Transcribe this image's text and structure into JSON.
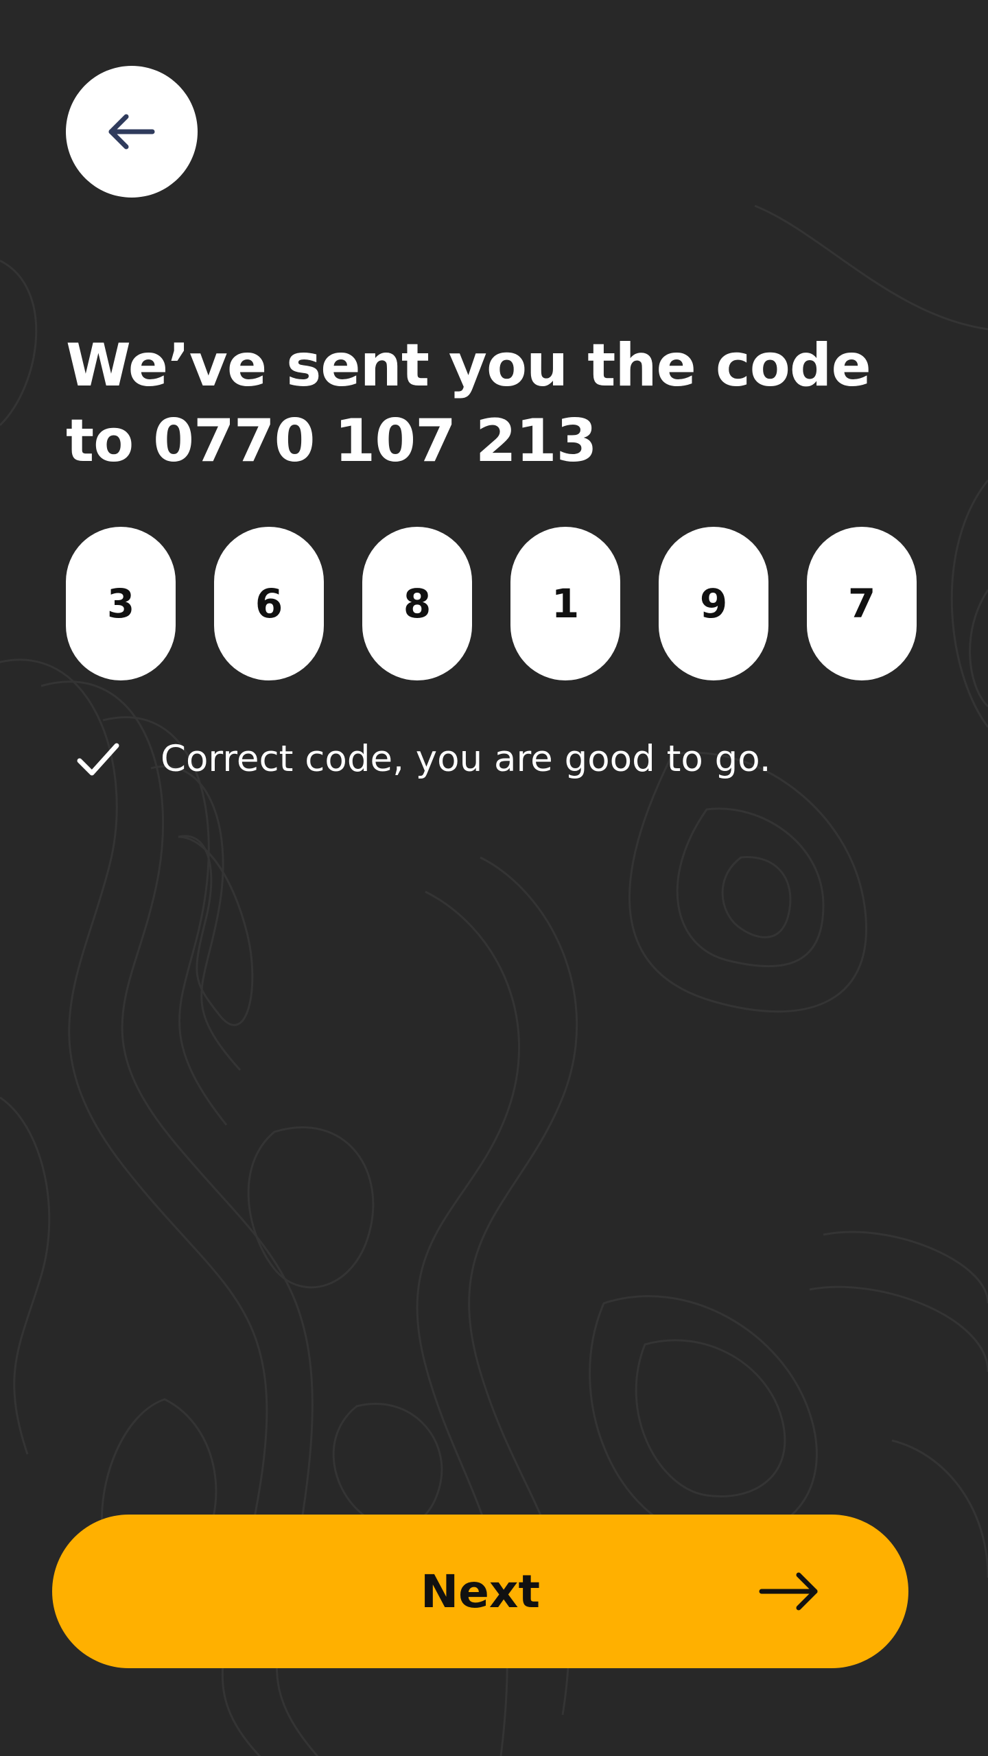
{
  "header": {
    "back_icon": "arrow-left-icon"
  },
  "headline": {
    "line1": "We’ve sent you the code",
    "line2": "to 0770 107 213"
  },
  "code": {
    "digits": [
      "3",
      "6",
      "8",
      "1",
      "9",
      "7"
    ]
  },
  "status": {
    "icon": "check-icon",
    "message": "Correct code, you are good to go."
  },
  "footer": {
    "next_label": "Next",
    "next_icon": "arrow-right-icon"
  },
  "colors": {
    "background": "#282828",
    "accent": "#ffb000",
    "surface": "#ffffff",
    "back_icon": "#2f3b5c"
  }
}
